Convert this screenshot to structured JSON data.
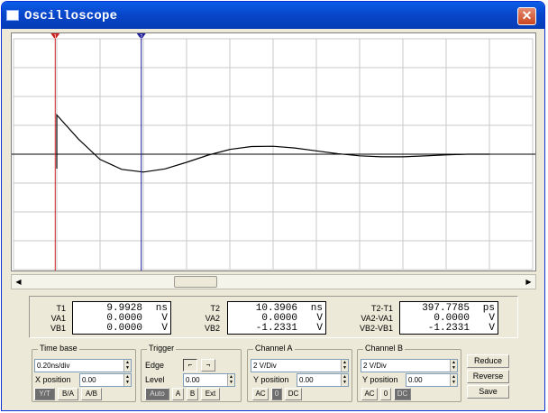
{
  "window": {
    "title": "Oscilloscope"
  },
  "readout": {
    "t1_label": "T1",
    "t1_value": "9.9928",
    "t1_unit": "ns",
    "va1_label": "VA1",
    "va1_value": "0.0000",
    "va1_unit": "V",
    "vb1_label": "VB1",
    "vb1_value": "0.0000",
    "vb1_unit": "V",
    "t2_label": "T2",
    "t2_value": "10.3906",
    "t2_unit": "ns",
    "va2_label": "VA2",
    "va2_value": "0.0000",
    "va2_unit": "V",
    "vb2_label": "VB2",
    "vb2_value": "-1.2331",
    "vb2_unit": "V",
    "dt_label": "T2-T1",
    "dt_value": "397.7785",
    "dt_unit": "ps",
    "dva_label": "VA2-VA1",
    "dva_value": "0.0000",
    "dva_unit": "V",
    "dvb_label": "VB2-VB1",
    "dvb_value": "-1.2331",
    "dvb_unit": "V"
  },
  "timebase": {
    "title": "Time base",
    "scale": "0.20ns/div",
    "xpos_label": "X position",
    "xpos_value": "0.00",
    "mode_yt": "Y/T",
    "mode_ba": "B/A",
    "mode_ab": "A/B"
  },
  "trigger": {
    "title": "Trigger",
    "edge_label": "Edge",
    "level_label": "Level",
    "level_value": "0.00",
    "auto": "Auto",
    "a": "A",
    "b": "B",
    "ext": "Ext"
  },
  "channel_a": {
    "title": "Channel A",
    "scale": "2 V/Div",
    "ypos_label": "Y position",
    "ypos_value": "0.00",
    "ac": "AC",
    "zero": "0",
    "dc": "DC"
  },
  "channel_b": {
    "title": "Channel B",
    "scale": "2 V/Div",
    "ypos_label": "Y position",
    "ypos_value": "0.00",
    "ac": "AC",
    "zero": "0",
    "dc": "DC"
  },
  "actions": {
    "reduce": "Reduce",
    "reverse": "Reverse",
    "save": "Save"
  },
  "cursors": {
    "cursor1_marker": "1",
    "cursor2_marker": "2"
  },
  "trace": {
    "color": "#000000",
    "points": [
      [
        10.0,
        -1.0
      ],
      [
        10.0,
        0.0
      ],
      [
        10.0,
        2.72
      ],
      [
        10.1,
        1.05
      ],
      [
        10.2,
        -0.36
      ],
      [
        10.3,
        -1.05
      ],
      [
        10.4,
        -1.24
      ],
      [
        10.5,
        -1.02
      ],
      [
        10.6,
        -0.56
      ],
      [
        10.7,
        -0.06
      ],
      [
        10.8,
        0.33
      ],
      [
        10.9,
        0.53
      ],
      [
        11.0,
        0.55
      ],
      [
        11.1,
        0.43
      ],
      [
        11.2,
        0.23
      ],
      [
        11.3,
        0.03
      ],
      [
        11.4,
        -0.11
      ],
      [
        11.5,
        -0.18
      ],
      [
        11.6,
        -0.18
      ],
      [
        11.7,
        -0.12
      ],
      [
        11.8,
        -0.05
      ],
      [
        11.9,
        0.0
      ],
      [
        12.0,
        0.0
      ]
    ]
  },
  "colors": {
    "cursor1": "#cc2020",
    "cursor2": "#1a1a9a",
    "grid": "#c8c8c8"
  }
}
